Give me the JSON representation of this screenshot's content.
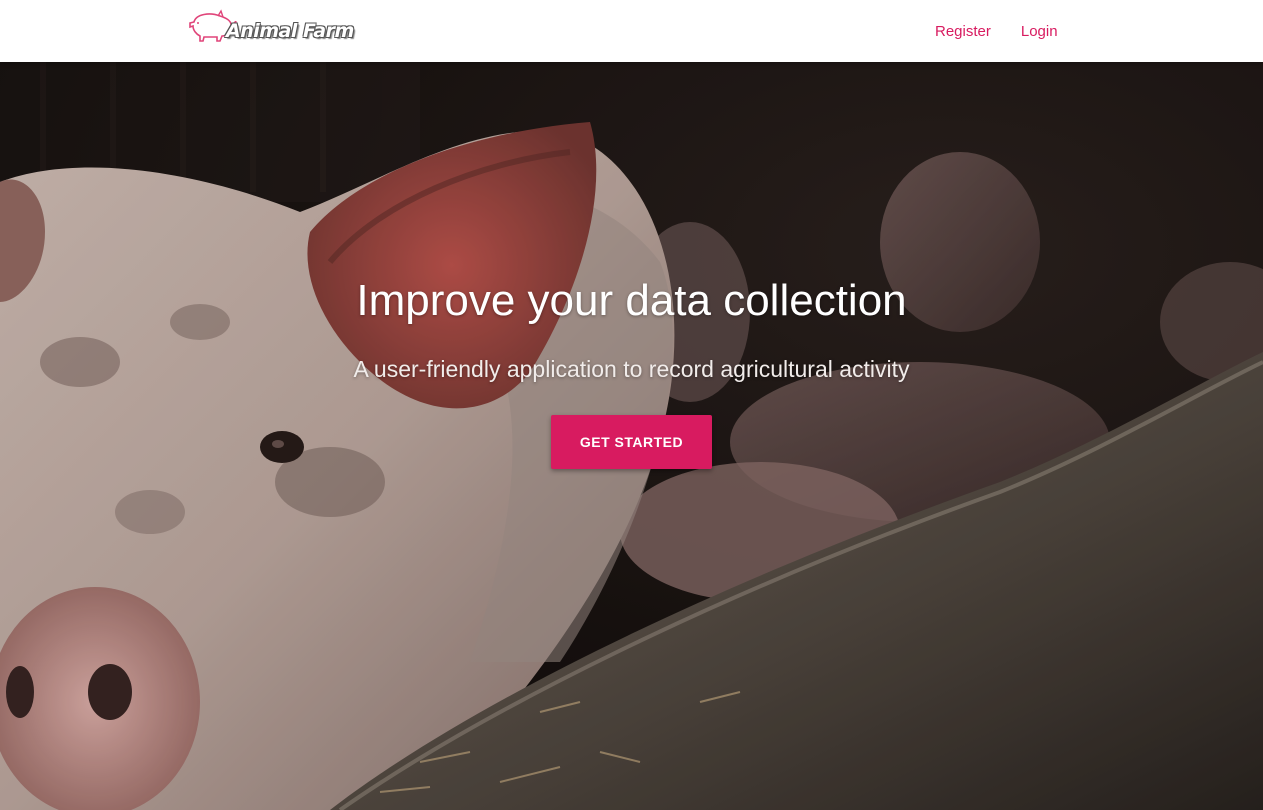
{
  "navbar": {
    "brand_text": "Animal Farm",
    "links": [
      {
        "label": "Register"
      },
      {
        "label": "Login"
      }
    ]
  },
  "hero": {
    "title": "Improve your data collection",
    "subtitle": "A user-friendly application to record agricultural activity",
    "cta_label": "GET STARTED",
    "image_subject": "pig-in-pen-photo"
  },
  "colors": {
    "accent": "#d81b60",
    "navbar_bg": "#ffffff",
    "hero_text": "#ffffff"
  }
}
